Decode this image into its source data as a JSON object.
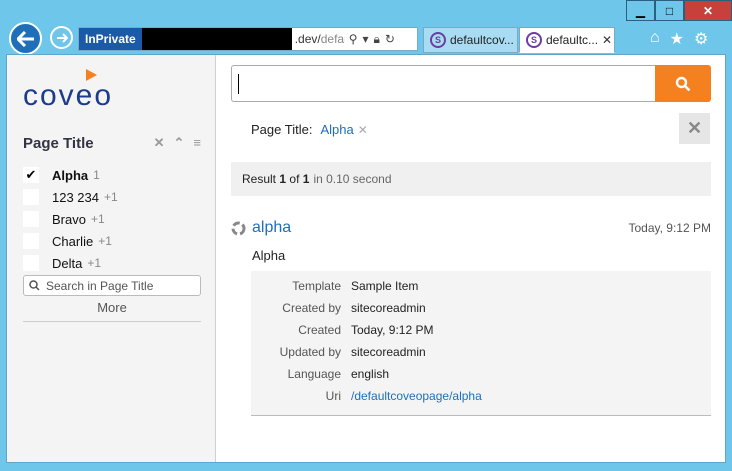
{
  "browser": {
    "inprivate_label": "InPrivate",
    "url_visible": ".dev/",
    "url_dim": "defau",
    "tabs": [
      {
        "title": "defaultcov..."
      },
      {
        "title": "defaultc..."
      }
    ],
    "icons": [
      "back-icon",
      "forward-icon",
      "home-icon",
      "favorites-star-icon",
      "settings-gear-icon"
    ]
  },
  "sidebar": {
    "logo_text": "coveo",
    "facet": {
      "title": "Page Title",
      "values": [
        {
          "label": "Alpha",
          "count": "1",
          "checked": true
        },
        {
          "label": "123 234",
          "count": "+1",
          "checked": false
        },
        {
          "label": "Bravo",
          "count": "+1",
          "checked": false
        },
        {
          "label": "Charlie",
          "count": "+1",
          "checked": false
        },
        {
          "label": "Delta",
          "count": "+1",
          "checked": false
        }
      ],
      "search_placeholder": "Search in Page Title",
      "more_label": "More"
    }
  },
  "main": {
    "search": {
      "value": ""
    },
    "breadcrumb": {
      "label": "Page Title:",
      "value": "Alpha"
    },
    "summary": {
      "prefix": "Result",
      "first": "1",
      "of": "of",
      "total": "1",
      "duration": "in 0.10 second"
    },
    "result": {
      "title": "alpha",
      "date": "Today, 9:12 PM",
      "excerpt": "Alpha",
      "fields": [
        {
          "key": "Template",
          "value": "Sample Item"
        },
        {
          "key": "Created by",
          "value": "sitecoreadmin"
        },
        {
          "key": "Created",
          "value": "Today, 9:12 PM"
        },
        {
          "key": "Updated by",
          "value": "sitecoreadmin"
        },
        {
          "key": "Language",
          "value": "english"
        },
        {
          "key": "Uri",
          "value": "/defaultcoveopage/alpha"
        }
      ]
    }
  },
  "colors": {
    "accent": "#f58020",
    "link": "#1e6fb8",
    "brand": "#1b3c8c"
  }
}
